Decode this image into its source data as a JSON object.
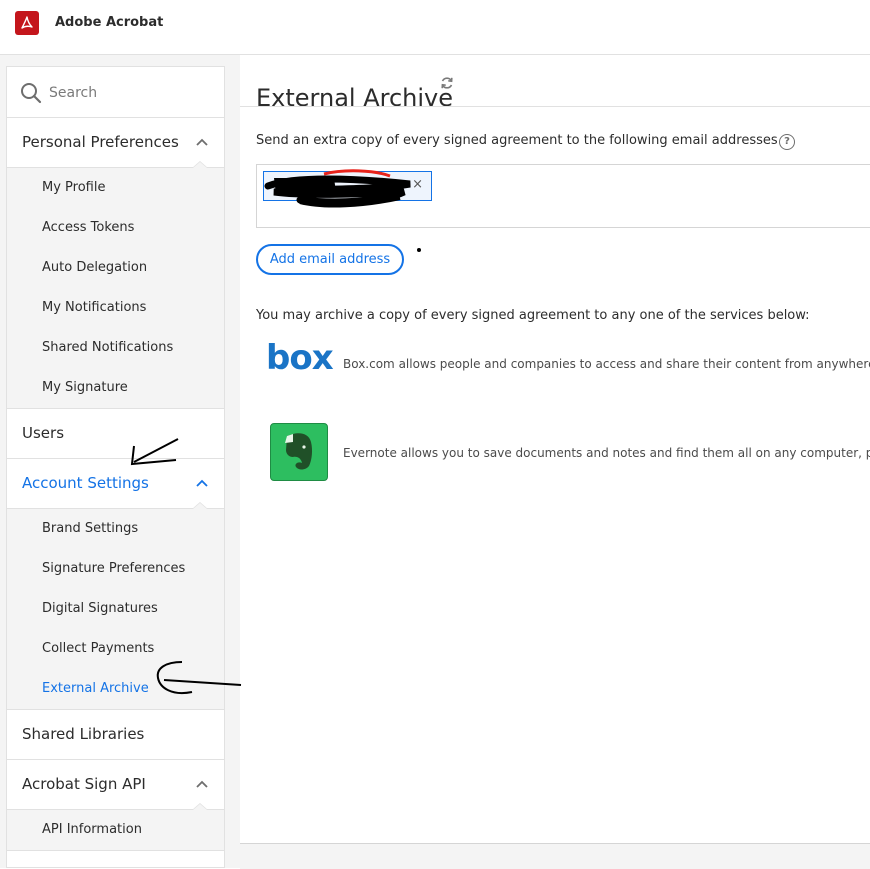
{
  "app": {
    "title": "Adobe Acrobat",
    "logo_icon": "adobe-acrobat-logo-icon",
    "brand_color": "#c4161c"
  },
  "sidebar": {
    "search_placeholder": "Search",
    "sections": [
      {
        "label": "Personal Preferences",
        "expanded": true,
        "active": false,
        "items": [
          "My Profile",
          "Access Tokens",
          "Auto Delegation",
          "My Notifications",
          "Shared Notifications",
          "My Signature"
        ]
      },
      {
        "label": "Users",
        "expanded": false,
        "active": false,
        "items": []
      },
      {
        "label": "Account Settings",
        "expanded": true,
        "active": true,
        "items": [
          "Brand Settings",
          "Signature Preferences",
          "Digital Signatures",
          "Collect Payments",
          "External Archive"
        ]
      },
      {
        "label": "Shared Libraries",
        "expanded": false,
        "active": false,
        "items": []
      },
      {
        "label": "Acrobat Sign API",
        "expanded": true,
        "active": false,
        "items": [
          "API Information"
        ]
      }
    ],
    "current_item": "External Archive"
  },
  "main": {
    "title": "External Archive",
    "email_description": "Send an extra copy of every signed agreement to the following email addresses",
    "email_chip_remove": "×",
    "add_email_label": "Add email address",
    "archive_description": "You may archive a copy of every signed agreement to any one of the services below:",
    "services": [
      {
        "logo_text": "box",
        "icon": "box-logo-icon",
        "description": "Box.com allows people and companies to access and share their content from anywhere. F"
      },
      {
        "icon": "evernote-logo-icon",
        "description": "Evernote allows you to save documents and notes and find them all on any computer, pho"
      }
    ]
  },
  "colors": {
    "accent": "#1473e6",
    "sidebar_bg": "#f4f4f4",
    "border": "#e1e1e1"
  }
}
